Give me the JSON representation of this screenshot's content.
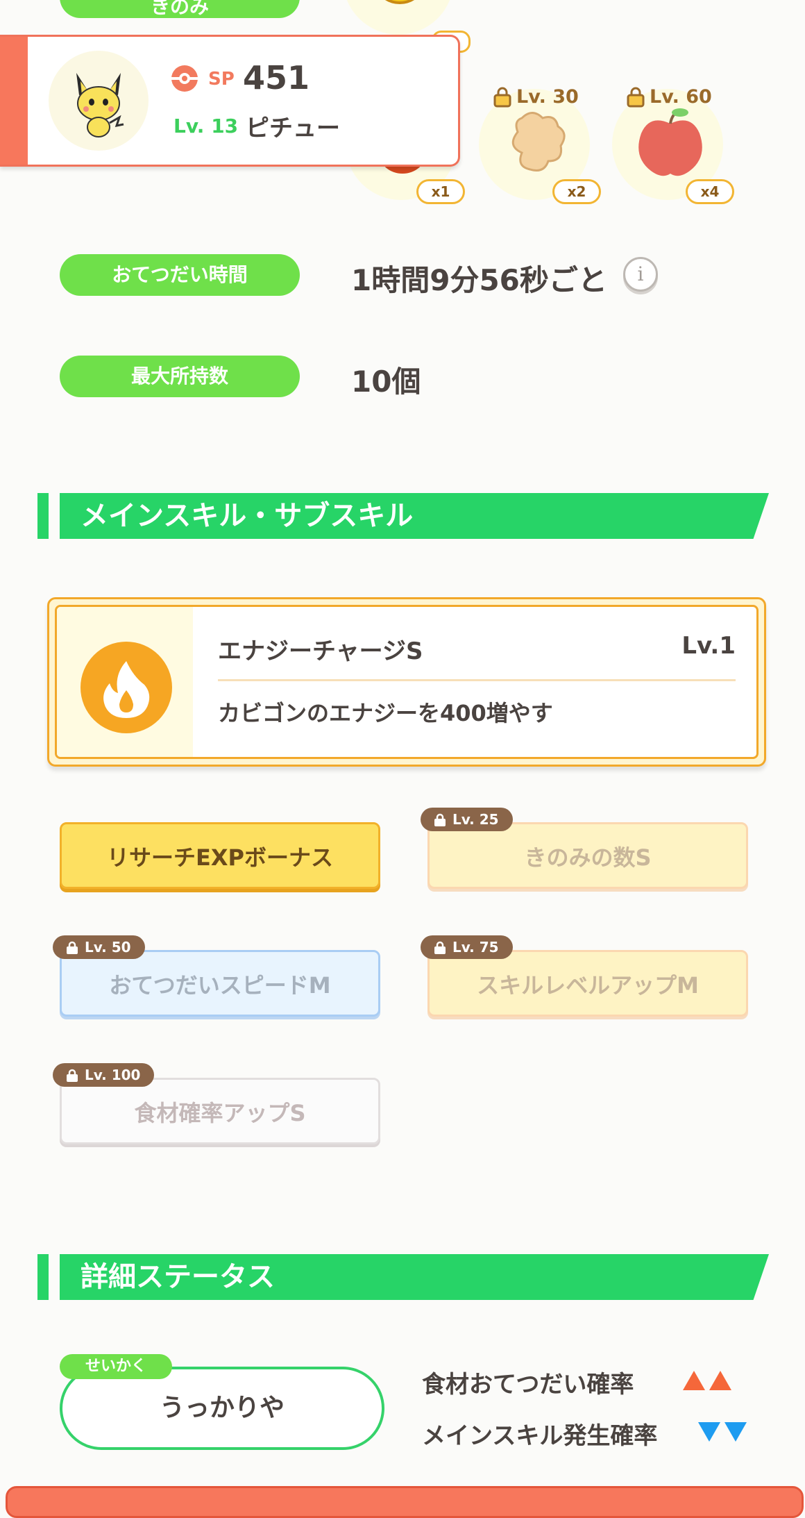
{
  "top": {
    "category_label": "きのみ"
  },
  "pokemon_card": {
    "sp_label": "SP",
    "sp_value": "451",
    "level": "Lv. 13",
    "name": "ピチュー"
  },
  "ingredients": [
    {
      "lock_level": "",
      "qty": "x1"
    },
    {
      "lock_level": "Lv. 30",
      "qty": "x2"
    },
    {
      "lock_level": "Lv. 60",
      "qty": "x4"
    }
  ],
  "help_time": {
    "label": "おてつだい時間",
    "value": "1時間9分56秒ごと",
    "info_icon": "i"
  },
  "max_carry": {
    "label": "最大所持数",
    "value": "10個"
  },
  "skills_section": {
    "title": "メインスキル・サブスキル"
  },
  "main_skill": {
    "name": "エナジーチャージS",
    "level": "Lv.1",
    "description": "カビゴンのエナジーを400増やす"
  },
  "sub_skills": [
    {
      "label": "リサーチEXPボーナス",
      "lock": ""
    },
    {
      "label": "きのみの数S",
      "lock": "Lv. 25"
    },
    {
      "label": "おてつだいスピードM",
      "lock": "Lv. 50"
    },
    {
      "label": "スキルレベルアップM",
      "lock": "Lv. 75"
    },
    {
      "label": "食材確率アップS",
      "lock": "Lv. 100"
    }
  ],
  "status_section": {
    "title": "詳細ステータス"
  },
  "nature": {
    "tag": "せいかく",
    "value": "うっかりや",
    "effects": [
      {
        "label": "食材おてつだい確率",
        "direction": "up"
      },
      {
        "label": "メインスキル発生確率",
        "direction": "down"
      }
    ]
  },
  "colors": {
    "accent_green": "#27d467",
    "pill_green": "#6fe04a",
    "card_red": "#f7775c",
    "skill_gold": "#f2a82a",
    "up_arrow": "#f5673a",
    "down_arrow": "#1e9cf0"
  }
}
